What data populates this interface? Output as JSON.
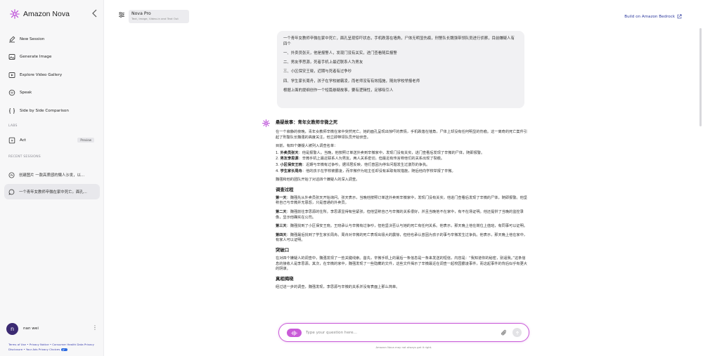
{
  "brand": {
    "name": "Amazon Nova"
  },
  "sidebar": {
    "nav": [
      {
        "label": "New Session",
        "icon": "new-session-icon"
      },
      {
        "label": "Generate Image",
        "icon": "image-icon"
      },
      {
        "label": "Explore Video Gallery",
        "icon": "video-icon"
      },
      {
        "label": "Speak",
        "icon": "speak-icon"
      },
      {
        "label": "Side by Side Comparison",
        "icon": "compare-icon"
      }
    ],
    "labs_label": "LABS",
    "act": {
      "label": "Act",
      "badge": "Preview"
    },
    "recent_label": "RECENT SESSIONS",
    "sessions": [
      {
        "label": "创建图片 一款高质感的懒人沙发，以...",
        "icon": "image-session-icon"
      },
      {
        "label": "一个青年女教师辛微在家中死亡。面孔...",
        "icon": "chat-session-icon"
      }
    ],
    "user": {
      "initial": "n",
      "name": "nan wei"
    },
    "footer": {
      "terms": "Terms of Use",
      "privacy": "Privacy Notice",
      "health": "Consumer Health Data Privacy",
      "disclosure": "Disclosure",
      "ads": "Your Ads Privacy Choices"
    }
  },
  "header": {
    "model_name": "Nova Pro",
    "model_sub": "Text, Image, Video-in and Text Out",
    "bedrock_link": "Build on Amazon Bedrock"
  },
  "chat": {
    "user_message": [
      "一个青年女教师辛微在家中死亡，面孔呈现惊吓状态，手机跌落在墙角，尸体无明显伤痕，刑警队长魏强带领队员进行侦察，目前嫌疑人有四个",
      "一、外卖员张天，他是报警人，发现门没有关实，进门查看随后报警",
      "二、男友李思源，死者手机上最近联系人为男友",
      "三、小区保安王晓，近期与死者有过争吵",
      "四、学生家长周舟，孩子在学校被霸凌，而老师没有有效措施，随向学校举报老师",
      "根据上面的提纲创作一个短篇悬疑故事，要有逻辑性，足够吸引人"
    ],
    "answer": {
      "title": "悬疑故事：青年女教师辛微之死",
      "intro": "在一个寂静的夜晚，青年女教师辛微在家中突然死亡。她的面孔呈现出惊吓的表情，手机跌落在墙角，尸体上却没有任何明显的伤痕。这一离奇的死亡案件引起了刑警队长魏强的高度关注，他立即带领队员开始侦查。",
      "suspects_intro": "目前，有四个嫌疑人被列入调查名单：",
      "suspects": [
        {
          "num": "1.",
          "name": "外卖员张天",
          "text": "：他是报警人。当晚，他按照订单送外卖到辛微家中，发现门没有关实，进门查看后发现了辛微的尸体，随即报警。"
        },
        {
          "num": "2.",
          "name": "男友李思源",
          "text": "：辛微手机上最近联系人为男友。两人关系密切，但最近有传言称他们的关系出现了裂痕。"
        },
        {
          "num": "3.",
          "name": "小区保安王晓",
          "text": "：近期与辛微有过争吵。据邻居反映，他们曾因为停车问题发生过激烈的争执。"
        },
        {
          "num": "4.",
          "name": "学生家长周舟",
          "text": "：他的孩子在学校被霸凌，而辛微作为班主任却没有采取有效措施，随后他向学校举报了辛微。"
        }
      ],
      "transition": "魏强和他的团队开始了对这四个嫌疑人的深入调查。",
      "section1": "调查过程",
      "days": [
        {
          "day": "第一天",
          "text": "：魏强先从外卖员张天开始询问。张天表示，当晚他按照订单送外卖到辛微家中，发现门没有关实，他进门查看后发现了辛微的尸体，随即报警。他坚称自己与辛微并无恩怨，只是普通的外卖员。"
        },
        {
          "day": "第二天",
          "text": "：魏强前往李思源的住所。李思源显得有些紧张，但他坚称自己与辛微的关系很好，并且当晚他不在家中，有不在场证明。他还提供了当晚的监控录像，显示他确实在公司。"
        },
        {
          "day": "第三天",
          "text": "：魏强找到了小区保安王晓。王晓承认与辛微有过争吵，但他坚决否认与她的死亡有任何关系。他表示，那天晚上他在岗位上值班，有同事可以证明。"
        },
        {
          "day": "第四天",
          "text": "：魏强最后找到了学生家长周舟。周舟对辛微的死亡表现出极大的震惊，但他也承认曾因为孩子的事与辛微发生过争执。他表示，那天晚上他在家中，有家人可以证明。"
        }
      ],
      "section2": "突破口",
      "breakthrough": "在对四个嫌疑人的调查中，魏强发现了一些关键线索。首先，辛微手机上的最后一条信息是一条来发送的短信，内容是：“我知道你的秘密，别逼我。”这条信息的接收人是李思源。其次，在辛微的家中，魏强发现了一些隐藏的文件，这些文件揭示了辛微最近在调查一起校园霸凌事件，而这起事件的背后似乎有更大的阴谋。",
      "section3": "真相揭晓",
      "reveal": "经过进一步的调查，魏强发现，李思源与辛微的关系并没有表面上那么简单。"
    }
  },
  "composer": {
    "placeholder": "Type your question here...",
    "disclaimer": "Amazon Nova may not always get it right."
  },
  "colors": {
    "accent": "#c95bd8",
    "link": "#2d3a9e",
    "avatar": "#3b2a72"
  }
}
